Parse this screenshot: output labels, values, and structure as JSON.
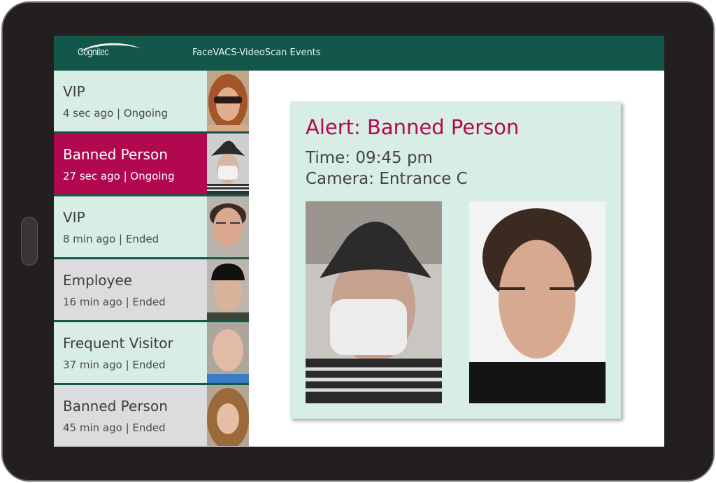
{
  "header": {
    "logo": "Cognitec",
    "title": "FaceVACS-VideoScan Events"
  },
  "colors": {
    "header": "#13574a",
    "accent": "#b2084f",
    "row_green": "#d8ede4",
    "row_gray": "#dcdcde"
  },
  "events": [
    {
      "title": "VIP",
      "sub": "4 sec ago | Ongoing"
    },
    {
      "title": "Banned Person",
      "sub": "27 sec ago | Ongoing"
    },
    {
      "title": "VIP",
      "sub": "8 min ago | Ended"
    },
    {
      "title": "Employee",
      "sub": "16 min ago | Ended"
    },
    {
      "title": "Frequent Visitor",
      "sub": "37 min ago | Ended"
    },
    {
      "title": "Banned Person",
      "sub": "45 min ago | Ended"
    }
  ],
  "detail": {
    "alert": "Alert: Banned Person",
    "time": "Time: 09:45 pm",
    "camera": "Camera: Entrance C"
  }
}
